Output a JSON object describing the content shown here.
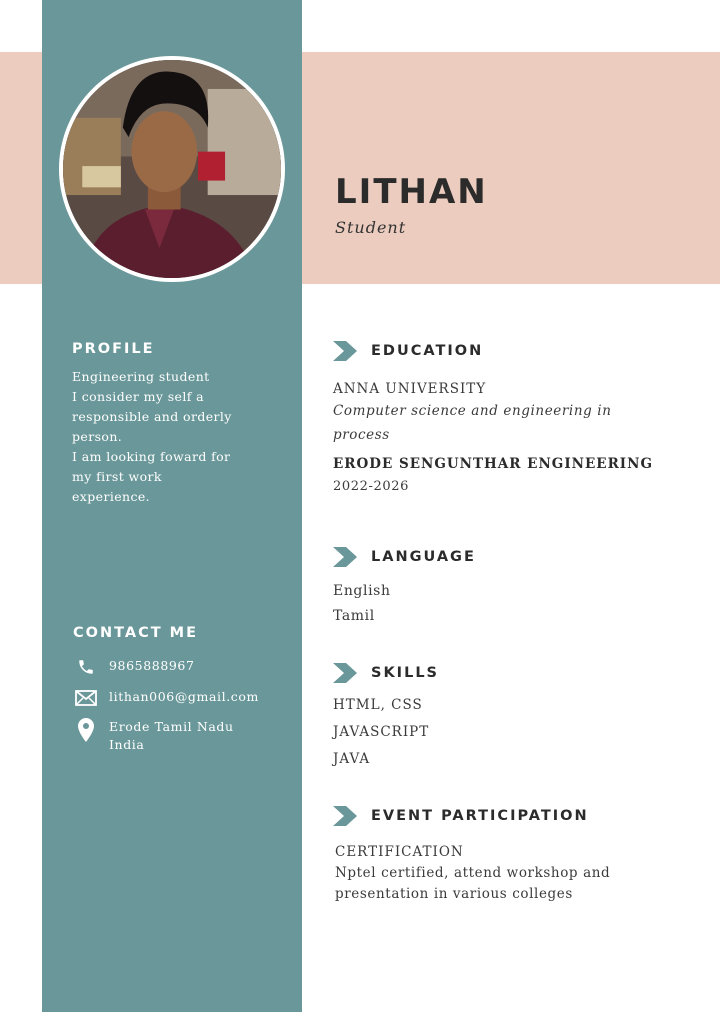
{
  "header": {
    "name": "LITHAN",
    "role": "Student"
  },
  "profile": {
    "heading": "PROFILE",
    "lines": [
      "Engineering student",
      "I consider my self a",
      "responsible and orderly",
      "person.",
      "I am looking foward for",
      "my first work",
      "experience."
    ]
  },
  "contact": {
    "heading": "CONTACT ME",
    "phone": "9865888967",
    "email": "lithan006@gmail.com",
    "location_line1": "Erode Tamil Nadu",
    "location_line2": "India"
  },
  "education": {
    "heading": "EDUCATION",
    "school1": "ANNA UNIVERSITY",
    "course_line1": "Computer science and engineering in",
    "course_line2": "process",
    "school2": "ERODE SENGUNTHAR ENGINEERING",
    "years": "2022-2026"
  },
  "language": {
    "heading": "LANGUAGE",
    "items": [
      "English",
      "Tamil"
    ]
  },
  "skills": {
    "heading": "SKILLS",
    "items": [
      "HTML, CSS",
      "JAVASCRIPT",
      "JAVA"
    ]
  },
  "events": {
    "heading": "EVENT PARTICIPATION",
    "title": "CERTIFICATION",
    "desc_line1": "Nptel certified, attend workshop and",
    "desc_line2": "presentation in various colleges"
  },
  "colors": {
    "sidebar": "#6a9799",
    "header_band": "#ecccbf",
    "arrow": "#6a9799"
  },
  "icons": {
    "phone": "phone-icon",
    "email": "envelope-icon",
    "location": "map-pin-icon",
    "section": "chevron-arrow-icon"
  }
}
